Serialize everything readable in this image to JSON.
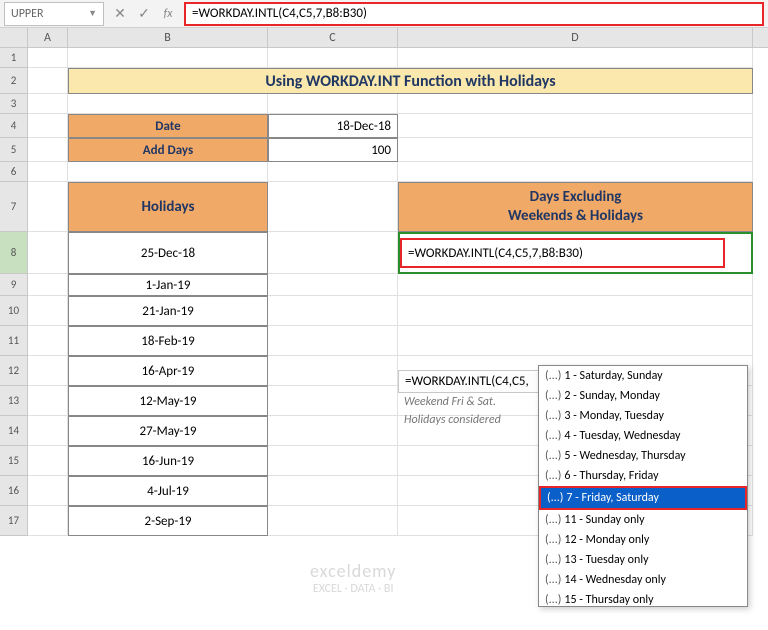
{
  "formulaBar": {
    "nameBox": "UPPER",
    "formula": "=WORKDAY.INTL(C4,C5,7,B8:B30)"
  },
  "colHeaders": {
    "A": "A",
    "B": "B",
    "C": "C",
    "D": "D"
  },
  "rowNums": [
    "1",
    "2",
    "3",
    "4",
    "5",
    "6",
    "7",
    "8",
    "9",
    "10",
    "11",
    "12",
    "13",
    "14",
    "15",
    "16",
    "17"
  ],
  "title": "Using WORKDAY.INT Function with Holidays",
  "inputs": {
    "dateLabel": "Date",
    "dateValue": "18-Dec-18",
    "addLabel": "Add Days",
    "addValue": "100"
  },
  "holidaysHeader": "Holidays",
  "holidays": [
    "25-Dec-18",
    "1-Jan-19",
    "21-Jan-19",
    "18-Feb-19",
    "16-Apr-19",
    "12-May-19",
    "27-May-19",
    "16-Jun-19",
    "4-Jul-19",
    "2-Sep-19"
  ],
  "resultHeader": "Days Excluding\nWeekends & Holidays",
  "resultFormula": "=WORKDAY.INTL(C4,C5,7,B8:B30)",
  "hint": {
    "line1": "=WORKDAY.INTL(C4,C5,",
    "line2": "Weekend Fri & Sat.",
    "line3": "Holidays considered"
  },
  "weekendOptions": [
    {
      "n": "1",
      "t": "Saturday, Sunday"
    },
    {
      "n": "2",
      "t": "Sunday, Monday"
    },
    {
      "n": "3",
      "t": "Monday, Tuesday"
    },
    {
      "n": "4",
      "t": "Tuesday, Wednesday"
    },
    {
      "n": "5",
      "t": "Wednesday, Thursday"
    },
    {
      "n": "6",
      "t": "Thursday, Friday"
    },
    {
      "n": "7",
      "t": "Friday, Saturday",
      "sel": true
    },
    {
      "n": "11",
      "t": "Sunday only"
    },
    {
      "n": "12",
      "t": "Monday only"
    },
    {
      "n": "13",
      "t": "Tuesday only"
    },
    {
      "n": "14",
      "t": "Wednesday only"
    },
    {
      "n": "15",
      "t": "Thursday only"
    }
  ],
  "watermark": {
    "brand": "exceldemy",
    "tag": "EXCEL · DATA · BI"
  },
  "chart_data": null
}
